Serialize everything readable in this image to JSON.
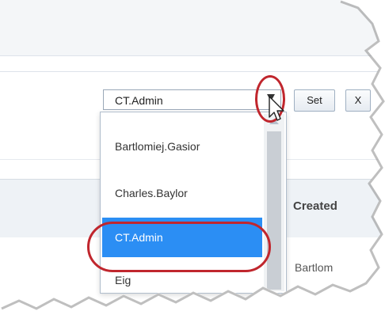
{
  "toolbar": {
    "select_value": "CT.Admin",
    "set_label": "Set",
    "clear_label": "X"
  },
  "dropdown": {
    "options": [
      "Bartlomiej.Gasior",
      "Charles.Baylor",
      "CT.Admin",
      "Eig"
    ],
    "selected": "CT.Admin"
  },
  "table": {
    "header_created": "Created",
    "row1_author": "Bartlom"
  },
  "colors": {
    "selection": "#2b8ef4",
    "callout_ring": "#c0262d"
  },
  "icons": {
    "dropdown_arrow": "chevron-down-icon",
    "scroll_up": "chevron-up-icon",
    "cursor": "mouse-pointer-icon"
  }
}
